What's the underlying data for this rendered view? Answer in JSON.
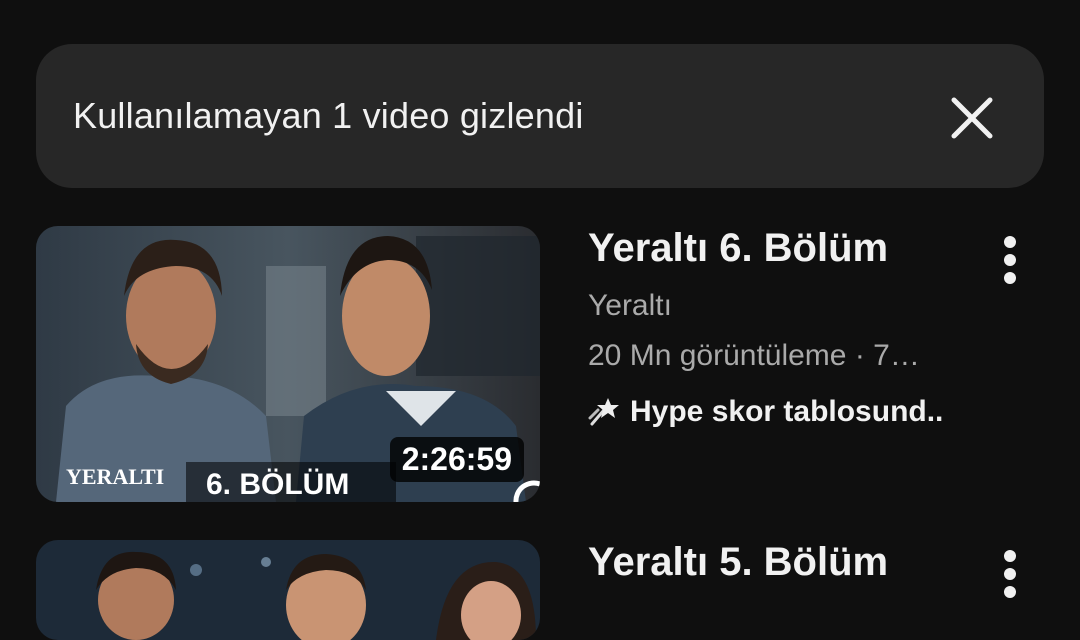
{
  "banner": {
    "text": "Kullanılamayan 1 video gizlendi",
    "close_icon": "close-icon"
  },
  "videos": [
    {
      "title": "Yeraltı 6. Bölüm",
      "channel": "Yeraltı",
      "meta": "20 Mn görüntüleme · 7…",
      "hype": "Hype skor tablosund..",
      "duration": "2:26:59",
      "thumb_logo": "YERALTI",
      "thumb_episode": "6. BÖLÜM",
      "hype_icon": "megaphone-icon",
      "more_icon": "more-vert-icon"
    },
    {
      "title": "Yeraltı 5. Bölüm",
      "more_icon": "more-vert-icon"
    }
  ],
  "colors": {
    "background": "#0f0f0f",
    "banner_bg": "#272727",
    "text_primary": "#f1f1f1",
    "text_secondary": "#aaaaaa"
  }
}
